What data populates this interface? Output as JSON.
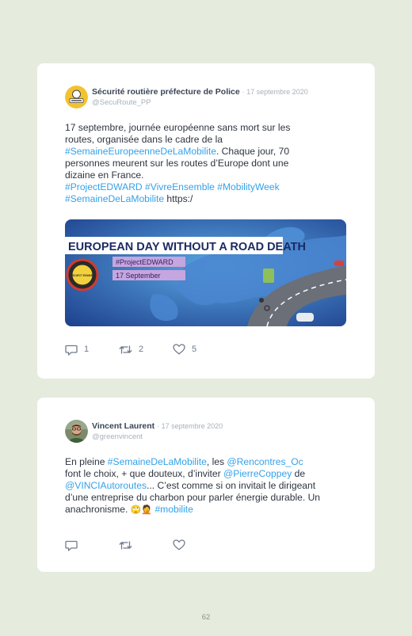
{
  "tweets": [
    {
      "author": "Sécurité routière préfecture de Police",
      "date": "· 17 septembre 2020",
      "handle": "@SecuRoute_PP",
      "text": {
        "l1": "17 septembre, journée européenne sans mort sur les",
        "l2": "routes, organisée dans le cadre de la",
        "l3_tag": "#SemaineEuropeenneDeLaMobilite",
        "l3_rest": ". Chaque jour, 70",
        "l4": "personnes meurent sur les routes d’Europe dont une",
        "l5": "dizaine en France.",
        "l6_tags": "#ProjectEDWARD #VivreEnsemble #MobilityWeek",
        "l7_tag": "#SemaineDeLaMobilite",
        "l7_rest": " https:/"
      },
      "media": {
        "headline": "EUROPEAN DAY WITHOUT A ROAD DEATH",
        "tag_label": "#ProjectEDWARD",
        "date_label": "17 September",
        "badge_text": "PROJECT EDWARD"
      },
      "replies": "1",
      "retweets": "2",
      "likes": "5"
    },
    {
      "author": "Vincent Laurent",
      "date": "· 17 septembre 2020",
      "handle": "@greenvincent",
      "text": {
        "l1_a": "En pleine ",
        "l1_tag": "#SemaineDeLaMobilite",
        "l1_b": ", les ",
        "l1_mention": "@Rencontres_Oc",
        "l2_a": "font le choix, + que douteux, d’inviter ",
        "l2_mention": "@PierreCoppey",
        "l2_b": " de",
        "l3_mention": "@VINCIAutoroutes",
        "l3_rest": "... C’est comme si on invitait le dirigeant",
        "l4": "d’une entreprise du charbon pour parler énergie durable. Un",
        "l5_a": "anachronisme. ",
        "l5_emoji": "🙄🤦",
        "l5_tag": " #mobilite"
      }
    }
  ],
  "page_number": "62",
  "colors": {
    "background": "#e5ecde",
    "link": "#33a1ea",
    "muted": "#a8b1bc"
  },
  "icons": [
    "reply-icon",
    "retweet-icon",
    "like-icon"
  ]
}
